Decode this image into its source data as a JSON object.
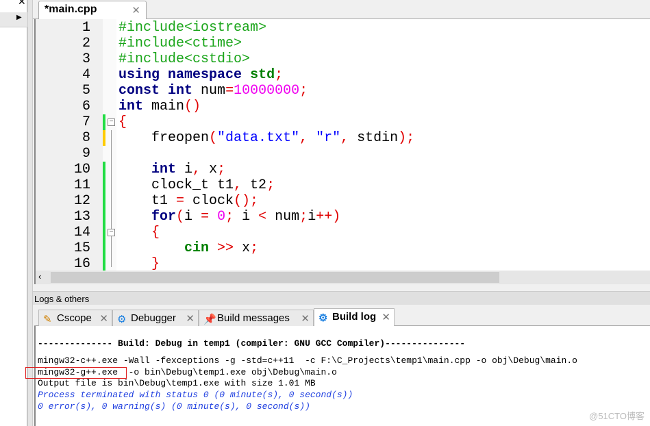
{
  "editor": {
    "tab": {
      "label": "*main.cpp",
      "close": "✕"
    },
    "lines": [
      {
        "n": "1",
        "change": "",
        "tokens": [
          [
            "pp",
            "#include<iostream>"
          ]
        ]
      },
      {
        "n": "2",
        "change": "",
        "tokens": [
          [
            "pp",
            "#include<ctime>"
          ]
        ]
      },
      {
        "n": "3",
        "change": "",
        "tokens": [
          [
            "pp",
            "#include<cstdio>"
          ]
        ]
      },
      {
        "n": "4",
        "change": "",
        "tokens": [
          [
            "kw",
            "using"
          ],
          [
            "id",
            " "
          ],
          [
            "kw",
            "namespace"
          ],
          [
            "id",
            " "
          ],
          [
            "ns",
            "std"
          ],
          [
            "op",
            ";"
          ]
        ]
      },
      {
        "n": "5",
        "change": "",
        "tokens": [
          [
            "kw",
            "const"
          ],
          [
            "id",
            " "
          ],
          [
            "kw",
            "int"
          ],
          [
            "id",
            " num"
          ],
          [
            "op",
            "="
          ],
          [
            "num",
            "10000000"
          ],
          [
            "op",
            ";"
          ]
        ]
      },
      {
        "n": "6",
        "change": "",
        "tokens": [
          [
            "kw",
            "int"
          ],
          [
            "id",
            " main"
          ],
          [
            "op",
            "()"
          ]
        ]
      },
      {
        "n": "7",
        "change": "saved",
        "fold": "open",
        "tokens": [
          [
            "op",
            "{"
          ]
        ]
      },
      {
        "n": "8",
        "change": "unsaved",
        "tokens": [
          [
            "id",
            "    freopen"
          ],
          [
            "op",
            "("
          ],
          [
            "str",
            "\"data.txt\""
          ],
          [
            "op",
            ","
          ],
          [
            "id",
            " "
          ],
          [
            "str",
            "\"r\""
          ],
          [
            "op",
            ","
          ],
          [
            "id",
            " stdin"
          ],
          [
            "op",
            ");"
          ]
        ]
      },
      {
        "n": "9",
        "change": "",
        "tokens": []
      },
      {
        "n": "10",
        "change": "saved",
        "tokens": [
          [
            "id",
            "    "
          ],
          [
            "kw",
            "int"
          ],
          [
            "id",
            " i"
          ],
          [
            "op",
            ","
          ],
          [
            "id",
            " x"
          ],
          [
            "op",
            ";"
          ]
        ]
      },
      {
        "n": "11",
        "change": "saved",
        "tokens": [
          [
            "id",
            "    clock_t t1"
          ],
          [
            "op",
            ","
          ],
          [
            "id",
            " t2"
          ],
          [
            "op",
            ";"
          ]
        ]
      },
      {
        "n": "12",
        "change": "saved",
        "tokens": [
          [
            "id",
            "    t1 "
          ],
          [
            "op",
            "="
          ],
          [
            "id",
            " clock"
          ],
          [
            "op",
            "();"
          ]
        ]
      },
      {
        "n": "13",
        "change": "saved",
        "tokens": [
          [
            "id",
            "    "
          ],
          [
            "kw",
            "for"
          ],
          [
            "op",
            "("
          ],
          [
            "id",
            "i "
          ],
          [
            "op",
            "="
          ],
          [
            "id",
            " "
          ],
          [
            "num",
            "0"
          ],
          [
            "op",
            ";"
          ],
          [
            "id",
            " i "
          ],
          [
            "op",
            "<"
          ],
          [
            "id",
            " num"
          ],
          [
            "op",
            ";"
          ],
          [
            "id",
            "i"
          ],
          [
            "op",
            "++)"
          ]
        ]
      },
      {
        "n": "14",
        "change": "saved",
        "fold": "open",
        "tokens": [
          [
            "id",
            "    "
          ],
          [
            "op",
            "{"
          ]
        ]
      },
      {
        "n": "15",
        "change": "saved",
        "tokens": [
          [
            "id",
            "        "
          ],
          [
            "ns",
            "cin"
          ],
          [
            "id",
            " "
          ],
          [
            "op",
            ">>"
          ],
          [
            "id",
            " x"
          ],
          [
            "op",
            ";"
          ]
        ]
      },
      {
        "n": "16",
        "change": "saved",
        "tokens": [
          [
            "id",
            "    "
          ],
          [
            "op",
            "}"
          ]
        ]
      }
    ],
    "colors": {
      "saved": "#22dd44",
      "unsaved": "#ffcc00"
    }
  },
  "scroll": {
    "left_arrow": "‹"
  },
  "logs": {
    "header": "Logs & others",
    "tabs": [
      {
        "label": "Cscope",
        "icon": "pencil-icon",
        "active": false
      },
      {
        "label": "Debugger",
        "icon": "gear-icon",
        "active": false
      },
      {
        "label": "Build messages",
        "icon": "pushpin-icon",
        "active": false
      },
      {
        "label": "Build log",
        "icon": "gear-icon",
        "active": true
      }
    ],
    "close": "✕",
    "lines": [
      {
        "text": "-------------- Build: Debug in temp1 (compiler: GNU GCC Compiler)---------------",
        "style": "b"
      },
      {
        "text": "mingw32-c++.exe -Wall -fexceptions -g -std=c++11  -c F:\\C_Projects\\temp1\\main.cpp -o obj\\Debug\\main.o",
        "style": ""
      },
      {
        "text": "mingw32-g++.exe  -o bin\\Debug\\temp1.exe obj\\Debug\\main.o",
        "style": ""
      },
      {
        "text": "Output file is bin\\Debug\\temp1.exe with size 1.01 MB",
        "style": ""
      },
      {
        "text": "Process terminated with status 0 (0 minute(s), 0 second(s))",
        "style": "blue"
      },
      {
        "text": "0 error(s), 0 warning(s) (0 minute(s), 0 second(s))",
        "style": "blue"
      }
    ]
  },
  "watermark": "@51CTO博客"
}
